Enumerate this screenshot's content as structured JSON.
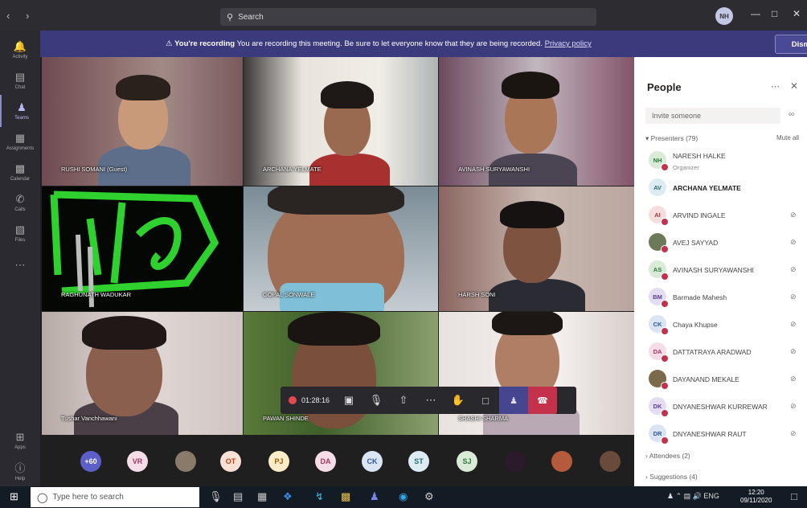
{
  "titlebar": {
    "back_icon": "chevron-left-icon",
    "forward_icon": "chevron-right-icon",
    "search_placeholder": "Search",
    "user_initials": "NH"
  },
  "rail": {
    "items": [
      {
        "label": "Activity",
        "icon": "bell-icon"
      },
      {
        "label": "Chat",
        "icon": "chat-icon"
      },
      {
        "label": "Teams",
        "icon": "teams-icon"
      },
      {
        "label": "Assignments",
        "icon": "assignment-icon"
      },
      {
        "label": "Calendar",
        "icon": "calendar-icon"
      },
      {
        "label": "Calls",
        "icon": "phone-icon"
      },
      {
        "label": "Files",
        "icon": "file-icon"
      },
      {
        "label": "Apps",
        "icon": "apps-icon"
      },
      {
        "label": "Help",
        "icon": "help-icon"
      }
    ]
  },
  "banner": {
    "bold": "You're recording",
    "text": " You are recording this meeting. Be sure to let everyone know that they are being recorded. ",
    "link": "Privacy policy",
    "dismiss": "Dismiss"
  },
  "tiles": [
    {
      "name": "RUSHI SOMANI (Guest)"
    },
    {
      "name": "ARCHANA YELMATE"
    },
    {
      "name": "AVINASH SURYAWANSHI"
    },
    {
      "name": "RAGHUNATH WADUKAR"
    },
    {
      "name": "GOPAL SONWALE"
    },
    {
      "name": "HARSH SONI"
    },
    {
      "name": "Tushar Vanchhawani"
    },
    {
      "name": "PAWAN SHINDE"
    },
    {
      "name": "SHASHI SHARMA"
    }
  ],
  "controls": {
    "timer": "01:28:16"
  },
  "strip": {
    "overflow": "+60",
    "chips": [
      "VR",
      "OT",
      "PJ",
      "DA",
      "CK",
      "ST",
      "SJ"
    ]
  },
  "panel": {
    "title": "People",
    "invite_placeholder": "Invite someone",
    "presenters": "Presenters (79)",
    "mute_all": "Mute all",
    "people": [
      {
        "initials": "NH",
        "name": "NARESH HALKE",
        "role": "Organizer",
        "bg": "#d9ead7",
        "fg": "#2b7a3c"
      },
      {
        "initials": "AV",
        "name": "ARCHANA YELMATE",
        "bg": "#dcecf2",
        "fg": "#2b6a7a"
      },
      {
        "initials": "AI",
        "name": "ARVIND INGALE",
        "bg": "#f6dede",
        "fg": "#a4373a"
      },
      {
        "initials": "",
        "name": "AVEJ SAYYAD",
        "bg": "#6d7a5a",
        "fg": "#fff"
      },
      {
        "initials": "AS",
        "name": "AVINASH SURYAWANSHI",
        "bg": "#d9ead7",
        "fg": "#2b7a3c"
      },
      {
        "initials": "BM",
        "name": "Barmade Mahesh",
        "bg": "#e4dcf2",
        "fg": "#5b3d91"
      },
      {
        "initials": "CK",
        "name": "Chaya Khupse",
        "bg": "#dbe4f3",
        "fg": "#2e5a9a"
      },
      {
        "initials": "DA",
        "name": "DATTATRAYA ARADWAD",
        "bg": "#f4dde7",
        "fg": "#a43763"
      },
      {
        "initials": "",
        "name": "DAYANAND MEKALE",
        "bg": "#7a6a4a",
        "fg": "#fff"
      },
      {
        "initials": "DK",
        "name": "DNYANESHWAR KURREWAR",
        "bg": "#e4dcf2",
        "fg": "#5b3d91"
      },
      {
        "initials": "DR",
        "name": "DNYANESHWAR RAUT",
        "bg": "#dbe4f3",
        "fg": "#2e5a9a"
      }
    ],
    "attendees": "Attendees (2)",
    "suggestions": "Suggestions (4)"
  },
  "taskbar": {
    "search_placeholder": "Type here to search",
    "tray": "ENG",
    "time": "12:20",
    "date": "09/11/2020"
  },
  "colors": {
    "accent": "#464590",
    "hangup": "#c4314b",
    "banner": "#3b3a7d"
  }
}
